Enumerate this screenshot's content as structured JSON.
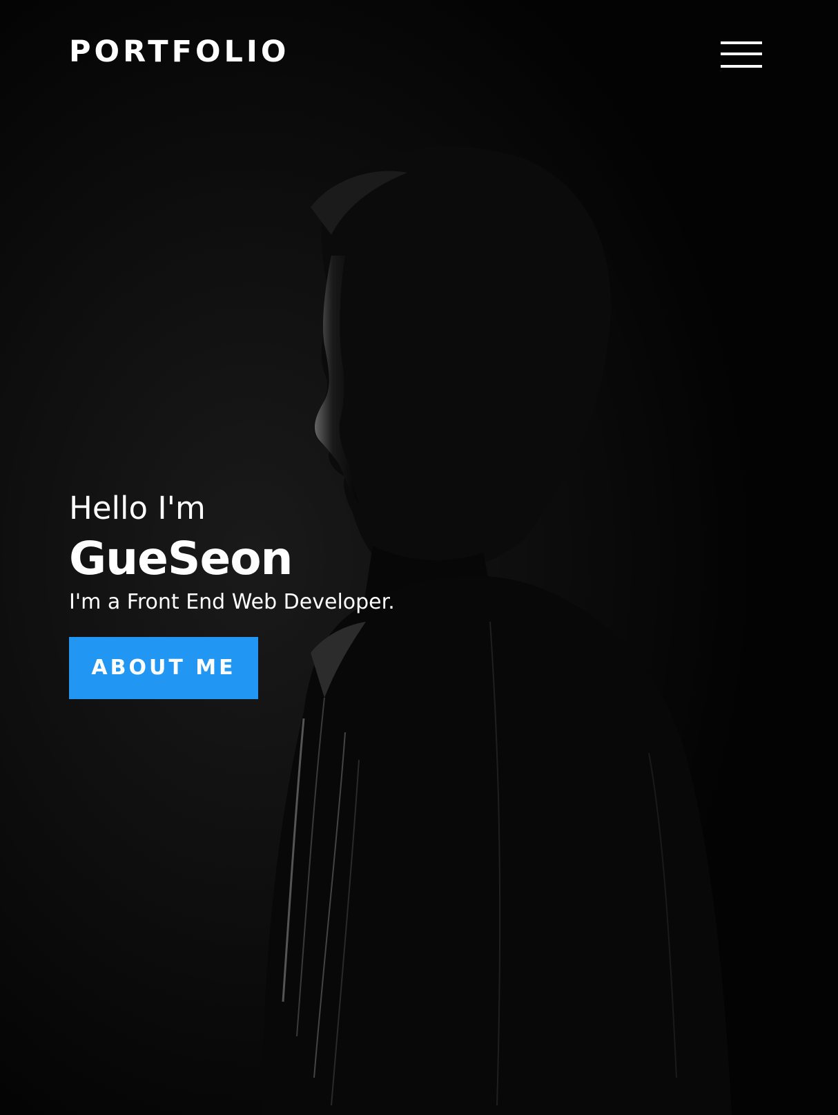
{
  "header": {
    "logo": "PORTFOLIO",
    "menu_icon": "hamburger-menu-icon"
  },
  "hero": {
    "greeting": "Hello I'm",
    "name": "GueSeon",
    "role": "I'm a Front End Web Developer.",
    "cta_label": "ABOUT ME"
  },
  "colors": {
    "background": "#030303",
    "text": "#ffffff",
    "accent": "#2196f3"
  }
}
